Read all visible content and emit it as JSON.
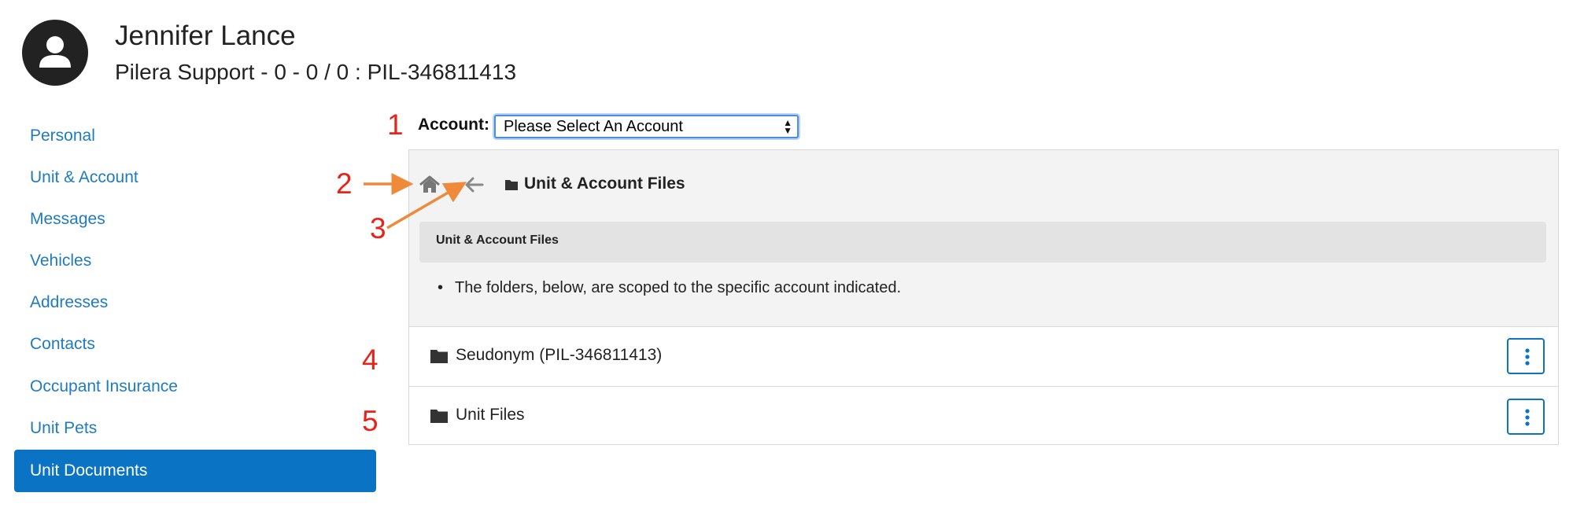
{
  "header": {
    "user_name": "Jennifer Lance",
    "subtitle": "Pilera Support - 0 - 0 / 0 : PIL-346811413"
  },
  "sidebar": {
    "items": [
      {
        "label": "Personal",
        "active": false
      },
      {
        "label": "Unit & Account",
        "active": false
      },
      {
        "label": "Messages",
        "active": false
      },
      {
        "label": "Vehicles",
        "active": false
      },
      {
        "label": "Addresses",
        "active": false
      },
      {
        "label": "Contacts",
        "active": false
      },
      {
        "label": "Occupant Insurance",
        "active": false
      },
      {
        "label": "Unit Pets",
        "active": false
      },
      {
        "label": "Unit Documents",
        "active": true
      }
    ]
  },
  "account": {
    "label": "Account:",
    "selected": "Please Select An Account"
  },
  "panel": {
    "title": "Unit & Account Files",
    "info_title": "Unit & Account Files",
    "info_text": "The folders, below, are scoped to the specific account indicated.",
    "folders": [
      {
        "name": "Seudonym (PIL-346811413)"
      },
      {
        "name": "Unit Files"
      }
    ]
  },
  "annotations": [
    "1",
    "2",
    "3",
    "4",
    "5"
  ],
  "colors": {
    "link": "#1f7bbf",
    "active_bg": "#0a73c3",
    "annotation_red": "#e8231a",
    "annotation_arrow": "#ee8a3a"
  }
}
